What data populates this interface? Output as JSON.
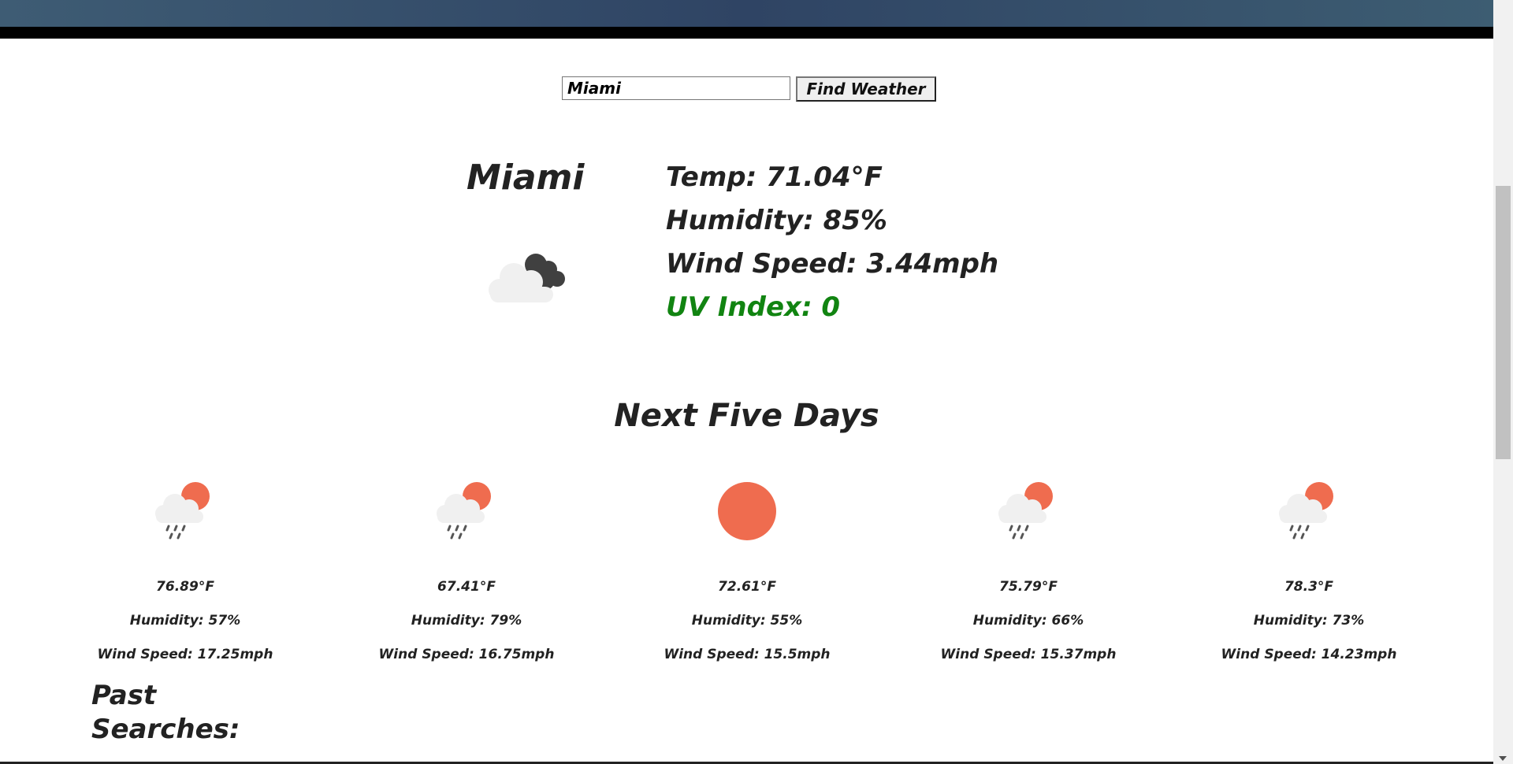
{
  "search": {
    "value": "Miami",
    "button_label": "Find Weather"
  },
  "current": {
    "city": "Miami",
    "icon": "cloudy-night-icon",
    "temp": "Temp: 71.04°F",
    "humidity": "Humidity: 85%",
    "wind": "Wind Speed: 3.44mph",
    "uv": "UV Index: 0",
    "uv_color": "#118411"
  },
  "forecast_title": "Next Five Days",
  "forecast": [
    {
      "icon": "rain-sun-icon",
      "temp": "76.89°F",
      "humidity": "Humidity: 57%",
      "wind": "Wind Speed: 17.25mph"
    },
    {
      "icon": "rain-sun-icon",
      "temp": "67.41°F",
      "humidity": "Humidity: 79%",
      "wind": "Wind Speed: 16.75mph"
    },
    {
      "icon": "sun-icon",
      "temp": "72.61°F",
      "humidity": "Humidity: 55%",
      "wind": "Wind Speed: 15.5mph"
    },
    {
      "icon": "rain-sun-icon",
      "temp": "75.79°F",
      "humidity": "Humidity: 66%",
      "wind": "Wind Speed: 15.37mph"
    },
    {
      "icon": "rain-sun-icon",
      "temp": "78.3°F",
      "humidity": "Humidity: 73%",
      "wind": "Wind Speed: 14.23mph"
    }
  ],
  "past_searches_title": "Past Searches:",
  "colors": {
    "sun": "#ef6c4f",
    "cloud": "#f0f0f0",
    "dark_cloud": "#404040",
    "rain": "#555555"
  }
}
